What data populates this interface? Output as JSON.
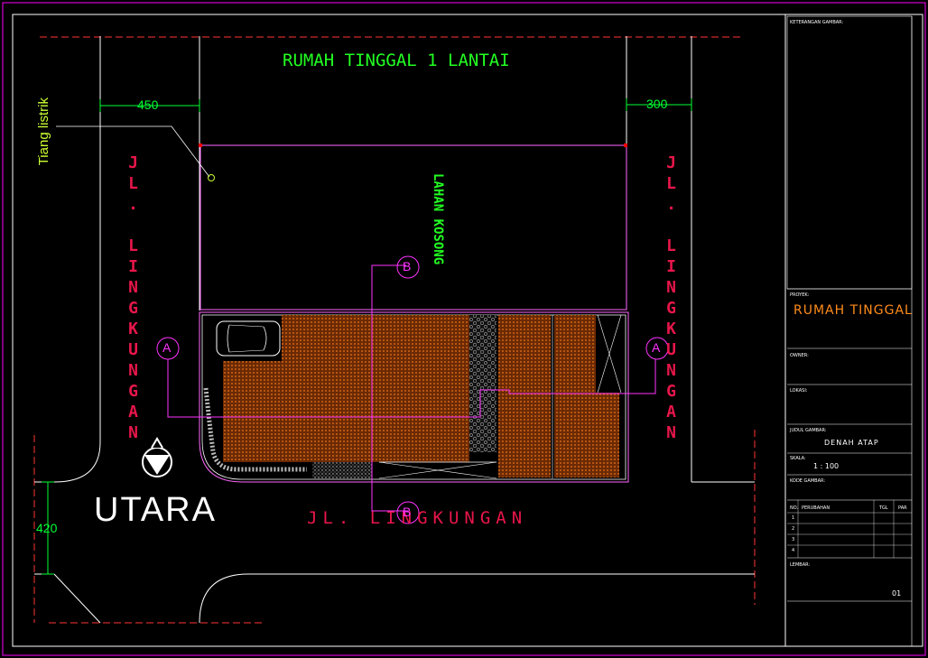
{
  "drawing": {
    "title": "RUMAH TINGGAL 1 LANTAI",
    "north_label": "UTARA",
    "vacant_lot_label": "LAHAN KOSONG",
    "utility_pole_label": "Tiang listrik",
    "road_left": "JL. LINGKUNGAN",
    "road_right": "JL. LINGKUNGAN",
    "road_bottom": "JL. LINGKUNGAN",
    "dim_left": "450",
    "dim_right": "300",
    "dim_bottom_left": "420",
    "section_a": "A",
    "section_b": "B"
  },
  "title_block": {
    "notes_label": "KETERANGAN GAMBAR:",
    "project_label": "PROYEK:",
    "project_value": "RUMAH TINGGAL",
    "owner_label": "OWNER:",
    "location_label": "LOKASI:",
    "drawing_title_label": "JUDUL GAMBAR:",
    "drawing_title_value": "DENAH ATAP",
    "scale_label": "SKALA:",
    "scale_value": "1 : 100",
    "drawing_code_label": "KODE GAMBAR:",
    "revision_headers": [
      "NO.",
      "PERUBAHAN",
      "TGL",
      "PAR"
    ],
    "revision_numbers": [
      "1",
      "2",
      "3",
      "4"
    ],
    "sheet_label": "LEMBAR:",
    "sheet_value": "01"
  },
  "colors": {
    "background": "#000000",
    "frame": "#ff00ff",
    "title_green": "#22ff22",
    "road_red": "#e8164a",
    "dimension_green": "#00ff33",
    "roof_brown": "#8a3c0a",
    "project_orange": "#ff8c1a",
    "label_yellow": "#ccff33"
  }
}
